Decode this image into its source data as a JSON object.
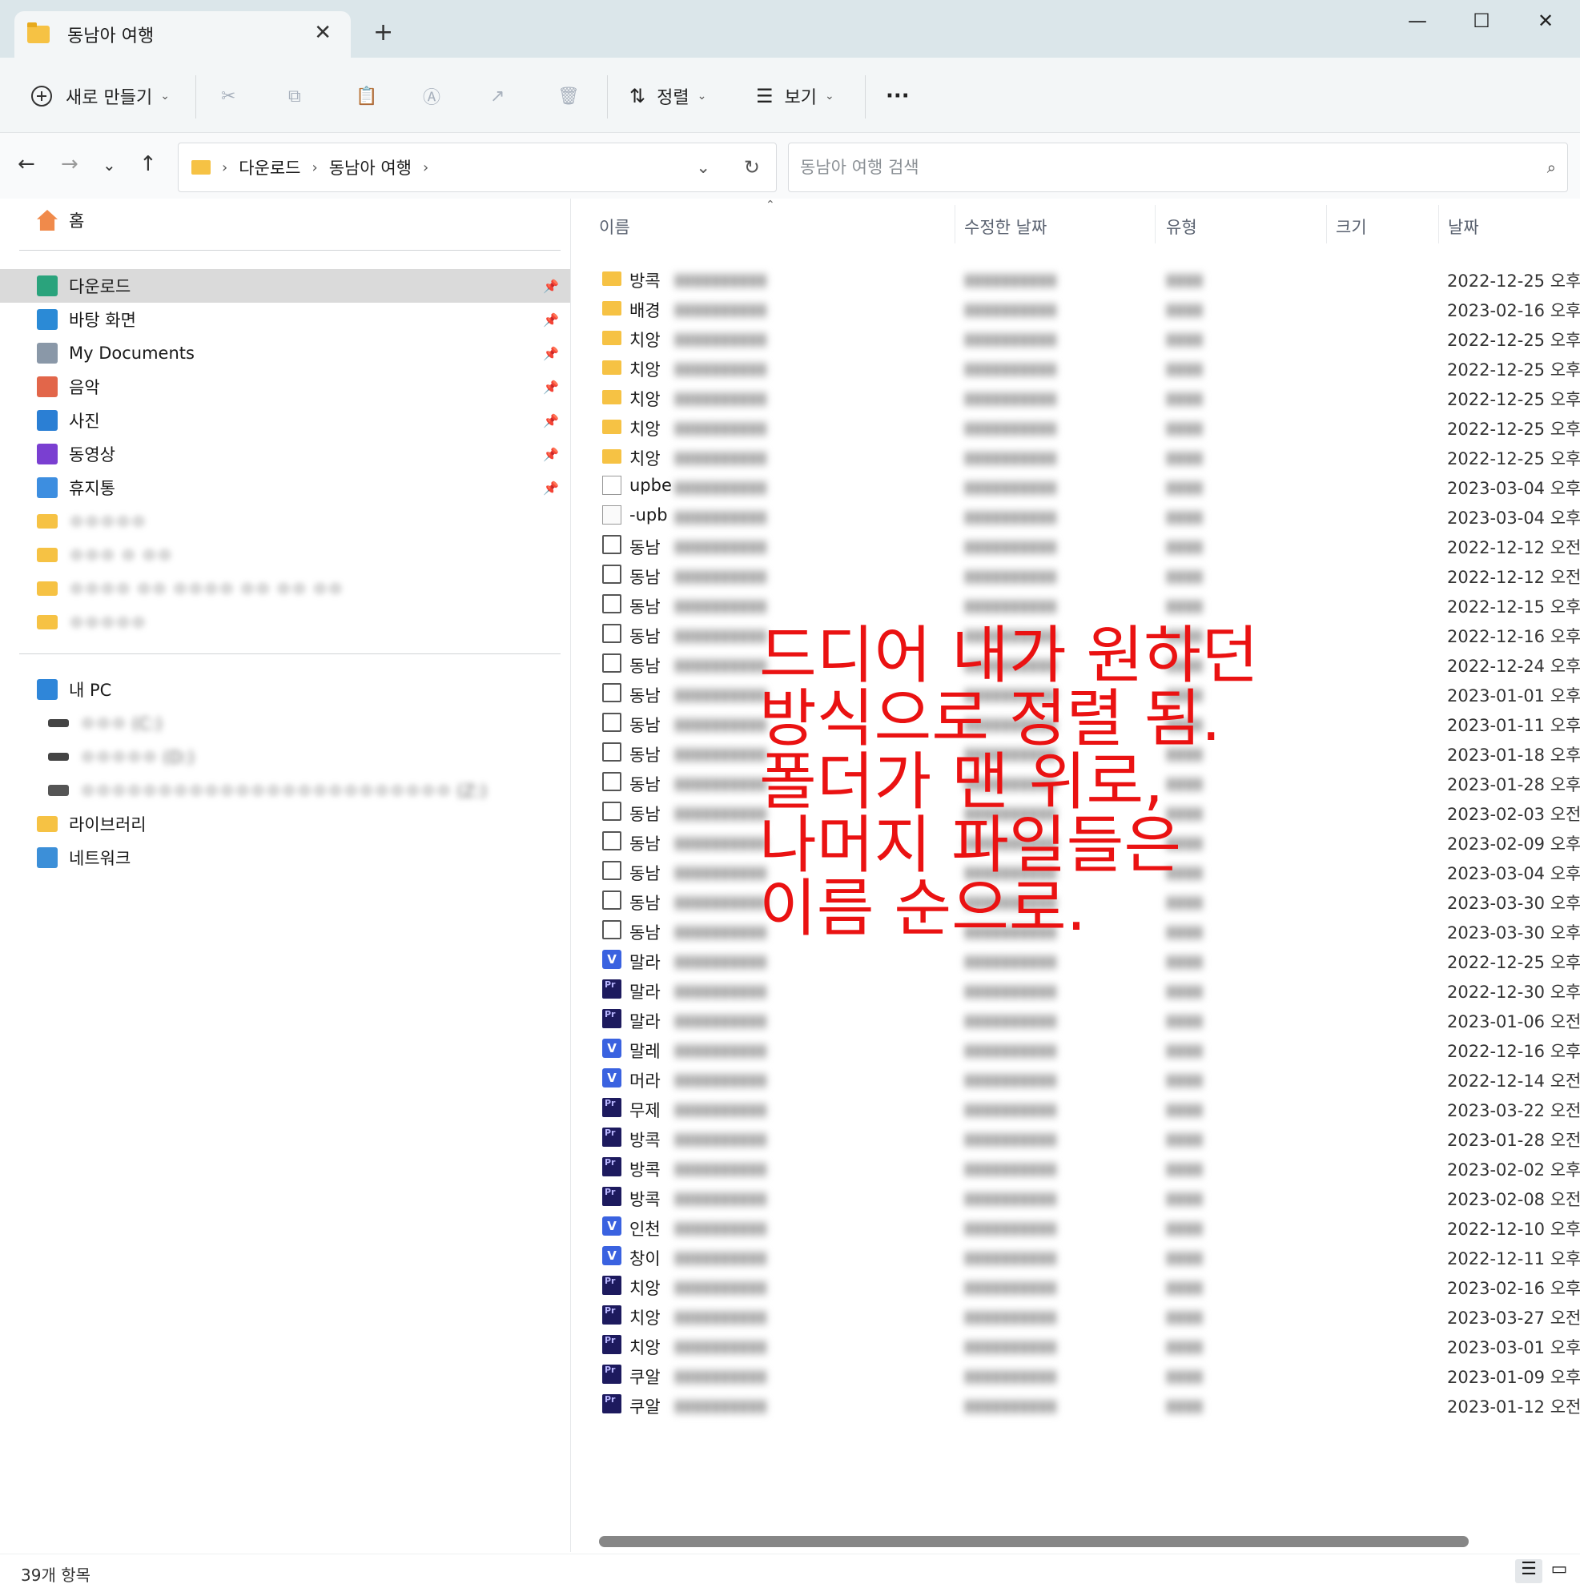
{
  "window": {
    "tab_title": "동남아 여행",
    "close_tab": "✕",
    "new_tab": "+",
    "minimize": "—",
    "maximize": "☐",
    "close": "✕"
  },
  "toolbar": {
    "new_label": "새로 만들기",
    "sort_label": "정렬",
    "view_label": "보기",
    "more": "···"
  },
  "nav": {
    "breadcrumb": [
      "다운로드",
      "동남아 여행"
    ],
    "search_placeholder": "동남아 여행 검색"
  },
  "sidebar": {
    "home": "홈",
    "quick_access": [
      {
        "label": "다운로드",
        "icon": "download-icon",
        "color": "#2aa37c"
      },
      {
        "label": "바탕 화면",
        "icon": "desktop-icon",
        "color": "#2b8ad6"
      },
      {
        "label": "My Documents",
        "icon": "documents-icon",
        "color": "#8a98a8"
      },
      {
        "label": "음악",
        "icon": "music-icon",
        "color": "#e2664a"
      },
      {
        "label": "사진",
        "icon": "pictures-icon",
        "color": "#2b7fd4"
      },
      {
        "label": "동영상",
        "icon": "videos-icon",
        "color": "#7a3fd1"
      },
      {
        "label": "휴지통",
        "icon": "recycle-bin-icon",
        "color": "#3d8ee0"
      }
    ],
    "blurred_folders": [
      "ㅇㅇㅇㅇㅇ",
      "ㅇㅇㅇ ㅇ ㅇㅇ",
      "ㅇㅇㅇㅇ ㅇㅇ ㅇㅇㅇㅇ ㅇㅇ ㅇㅇ ㅇㅇ",
      "ㅇㅇㅇㅇㅇ"
    ],
    "this_pc": "내 PC",
    "drives": [
      "ㅇㅇㅇ (C:)",
      "ㅇㅇㅇㅇㅇ (D:)",
      "ㅇㅇㅇㅇㅇㅇㅇㅇㅇㅇㅇㅇㅇㅇㅇㅇㅇㅇㅇㅇㅇㅇㅇㅇ (Z:)"
    ],
    "libraries": "라이브러리",
    "network": "네트워크"
  },
  "columns": {
    "name": "이름",
    "modified": "수정한 날짜",
    "type": "유형",
    "size": "크기",
    "date": "날짜"
  },
  "files": [
    {
      "name": "방콕",
      "icon": "folder-icon",
      "date": "2022-12-25 오후"
    },
    {
      "name": "배경",
      "icon": "folder-icon",
      "date": "2023-02-16 오후"
    },
    {
      "name": "치앙",
      "icon": "folder-icon",
      "date": "2022-12-25 오후"
    },
    {
      "name": "치앙",
      "icon": "folder-icon",
      "date": "2022-12-25 오후"
    },
    {
      "name": "치앙",
      "icon": "folder-icon",
      "date": "2022-12-25 오후"
    },
    {
      "name": "치앙",
      "icon": "folder-icon",
      "date": "2022-12-25 오후"
    },
    {
      "name": "치앙",
      "icon": "folder-icon",
      "date": "2022-12-25 오후"
    },
    {
      "name": "upbe",
      "icon": "media-file-icon",
      "date": "2023-03-04 오후"
    },
    {
      "name": "-upb",
      "icon": "text-file-icon",
      "date": "2023-03-04 오후"
    },
    {
      "name": "동남",
      "icon": "image-file-icon",
      "date": "2022-12-12 오전"
    },
    {
      "name": "동남",
      "icon": "image-file-icon",
      "date": "2022-12-12 오전"
    },
    {
      "name": "동남",
      "icon": "image-file-icon",
      "date": "2022-12-15 오후"
    },
    {
      "name": "동남",
      "icon": "image-file-icon",
      "date": "2022-12-16 오후"
    },
    {
      "name": "동남",
      "icon": "image-file-icon",
      "date": "2022-12-24 오후"
    },
    {
      "name": "동남",
      "icon": "image-file-icon",
      "date": "2023-01-01 오후"
    },
    {
      "name": "동남",
      "icon": "image-file-icon",
      "date": "2023-01-11 오후"
    },
    {
      "name": "동남",
      "icon": "image-file-icon",
      "date": "2023-01-18 오후"
    },
    {
      "name": "동남",
      "icon": "image-file-icon",
      "date": "2023-01-28 오후"
    },
    {
      "name": "동남",
      "icon": "image-file-icon",
      "date": "2023-02-03 오전"
    },
    {
      "name": "동남",
      "icon": "image-file-icon",
      "date": "2023-02-09 오후"
    },
    {
      "name": "동남",
      "icon": "image-file-icon",
      "date": "2023-03-04 오후"
    },
    {
      "name": "동남",
      "icon": "image-file-icon",
      "date": "2023-03-30 오후"
    },
    {
      "name": "동남",
      "icon": "image-file-icon",
      "date": "2023-03-30 오후"
    },
    {
      "name": "말라",
      "icon": "vrew-file-icon",
      "date": "2022-12-25 오후"
    },
    {
      "name": "말라",
      "icon": "premiere-file-icon",
      "date": "2022-12-30 오후"
    },
    {
      "name": "말라",
      "icon": "premiere-file-icon",
      "date": "2023-01-06 오전"
    },
    {
      "name": "말레",
      "icon": "vrew-file-icon",
      "date": "2022-12-16 오후"
    },
    {
      "name": "머라",
      "icon": "vrew-file-icon",
      "date": "2022-12-14 오전"
    },
    {
      "name": "무제",
      "icon": "premiere-file-icon",
      "date": "2023-03-22 오전"
    },
    {
      "name": "방콕",
      "icon": "premiere-file-icon",
      "date": "2023-01-28 오전"
    },
    {
      "name": "방콕",
      "icon": "premiere-file-icon",
      "date": "2023-02-02 오후"
    },
    {
      "name": "방콕",
      "icon": "premiere-file-icon",
      "date": "2023-02-08 오전"
    },
    {
      "name": "인천",
      "icon": "vrew-file-icon",
      "date": "2022-12-10 오후"
    },
    {
      "name": "창이",
      "icon": "vrew-file-icon",
      "date": "2022-12-11 오후"
    },
    {
      "name": "치앙",
      "icon": "premiere-file-icon",
      "date": "2023-02-16 오후"
    },
    {
      "name": "치앙",
      "icon": "premiere-file-icon",
      "date": "2023-03-27 오전"
    },
    {
      "name": "치앙",
      "icon": "premiere-file-icon",
      "date": "2023-03-01 오후"
    },
    {
      "name": "쿠알",
      "icon": "premiere-file-icon",
      "date": "2023-01-09 오후"
    },
    {
      "name": "쿠알",
      "icon": "premiere-file-icon",
      "date": "2023-01-12 오전"
    }
  ],
  "annotation": [
    "드디어 내가 원하던",
    "방식으로 정렬 됨.",
    "폴더가 맨 위로,",
    "나머지 파일들은",
    "이름 순으로."
  ],
  "status": {
    "count": "39개 항목"
  },
  "colors": {
    "annotation": "#ea1212",
    "selected_sidebar": "#dadada",
    "folder": "#f6c244"
  }
}
